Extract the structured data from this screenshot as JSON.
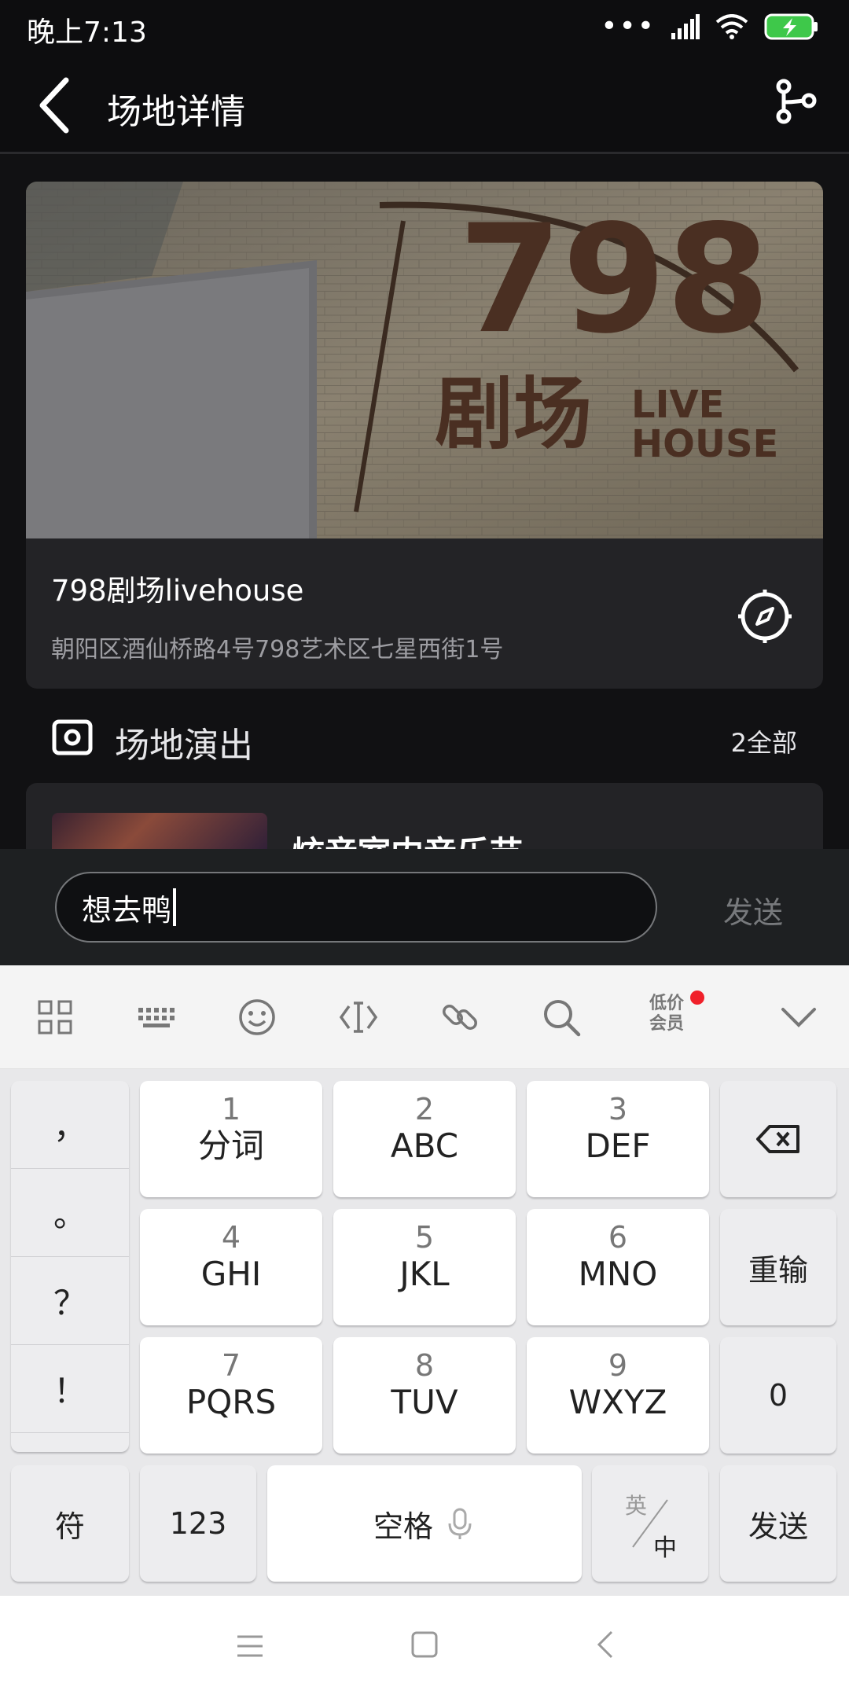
{
  "status_bar": {
    "time": "晚上7:13"
  },
  "header": {
    "title": "场地详情"
  },
  "venue": {
    "name": "798剧场livehouse",
    "address": "朝阳区酒仙桥路4号798艺术区七星西街1号",
    "photo_sign": {
      "number": "798",
      "label_cn": "剧场",
      "label_en_1": "LIVE",
      "label_en_2": "HOUSE"
    }
  },
  "shows": {
    "title": "场地演出",
    "count_label": "2全部",
    "items": [
      {
        "title": "炫音室内音乐节"
      }
    ]
  },
  "comment": {
    "value": "想去鸭",
    "send_label": "发送"
  },
  "keyboard": {
    "toolbar": {
      "vip_line1": "低价",
      "vip_line2": "会员"
    },
    "punctuation": [
      "，",
      "。",
      "？",
      "！"
    ],
    "keys": [
      {
        "num": "1",
        "letters": "分词"
      },
      {
        "num": "2",
        "letters": "ABC"
      },
      {
        "num": "3",
        "letters": "DEF"
      },
      {
        "num": "4",
        "letters": "GHI"
      },
      {
        "num": "5",
        "letters": "JKL"
      },
      {
        "num": "6",
        "letters": "MNO"
      },
      {
        "num": "7",
        "letters": "PQRS"
      },
      {
        "num": "8",
        "letters": "TUV"
      },
      {
        "num": "9",
        "letters": "WXYZ"
      }
    ],
    "reinput_label": "重输",
    "zero_label": "0",
    "symbol_label": "符",
    "num_label": "123",
    "space_label": "空格",
    "lang_en": "英",
    "lang_cn": "中",
    "send_label": "发送"
  },
  "colors": {
    "accent_dot": "#f0202a",
    "background": "#111113",
    "card": "#232326"
  }
}
